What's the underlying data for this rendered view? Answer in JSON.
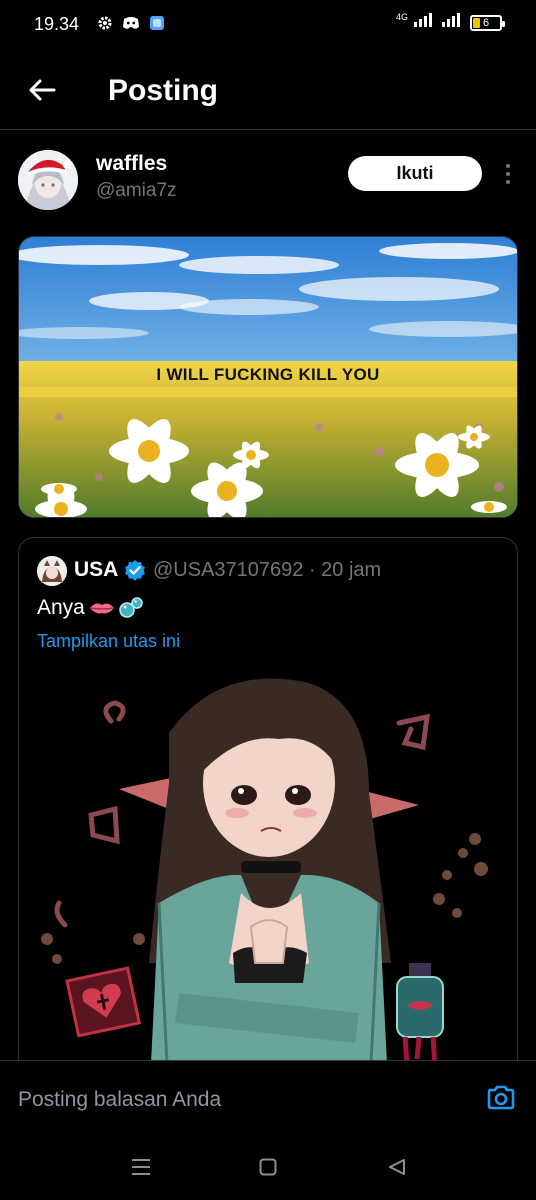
{
  "status_bar": {
    "time": "19.34",
    "network": "4G",
    "battery": "6"
  },
  "header": {
    "title": "Posting"
  },
  "post": {
    "author_name": "waffles",
    "author_handle": "@amia7z",
    "follow_label": "Ikuti",
    "meme_text": "I WILL FUCKING KILL YOU"
  },
  "quote": {
    "name": "USA",
    "handle_time": "@USA37107692 · 20 jam",
    "text": "Anya",
    "show_thread": "Tampilkan utas ini"
  },
  "reply": {
    "placeholder": "Posting balasan Anda"
  },
  "colors": {
    "background": "#000000",
    "accent": "#1d9bf0",
    "border": "#2f3336",
    "muted": "#71767b"
  },
  "icons": {
    "back": "arrow-left-icon",
    "more": "more-vertical-icon",
    "verified": "verified-badge-icon",
    "camera": "camera-icon"
  }
}
